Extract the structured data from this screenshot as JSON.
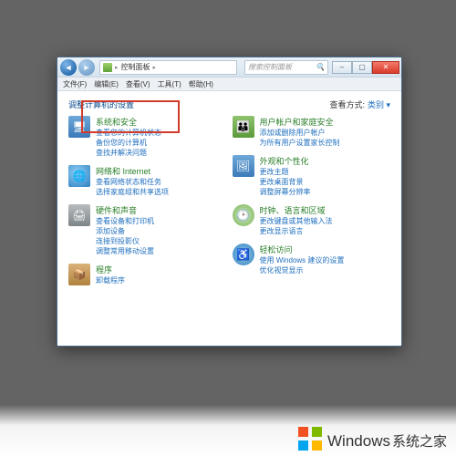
{
  "titlebar": {
    "breadcrumb": "控制面板",
    "search_placeholder": "搜索控制面板"
  },
  "menubar": [
    "文件(F)",
    "编辑(E)",
    "查看(V)",
    "工具(T)",
    "帮助(H)"
  ],
  "header": {
    "title": "调整计算机的设置",
    "view_label": "查看方式:",
    "view_value": "类别"
  },
  "left": [
    {
      "title": "系统和安全",
      "links": [
        "查看您的计算机状态",
        "备份您的计算机",
        "查找并解决问题"
      ]
    },
    {
      "title": "网络和 Internet",
      "links": [
        "查看网络状态和任务",
        "选择家庭组和共享选项"
      ]
    },
    {
      "title": "硬件和声音",
      "links": [
        "查看设备和打印机",
        "添加设备",
        "连接到投影仪",
        "调整常用移动设置"
      ]
    },
    {
      "title": "程序",
      "links": [
        "卸载程序"
      ]
    }
  ],
  "right": [
    {
      "title": "用户帐户和家庭安全",
      "links": [
        "添加或删除用户帐户",
        "为所有用户设置家长控制"
      ]
    },
    {
      "title": "外观和个性化",
      "links": [
        "更改主题",
        "更改桌面背景",
        "调整屏幕分辨率"
      ]
    },
    {
      "title": "时钟、语言和区域",
      "links": [
        "更改键盘或其他输入法",
        "更改显示语言"
      ]
    },
    {
      "title": "轻松访问",
      "links": [
        "使用 Windows 建议的设置",
        "优化视觉显示"
      ]
    }
  ],
  "watermark": {
    "brand": "Windows",
    "site": "系统之家"
  }
}
